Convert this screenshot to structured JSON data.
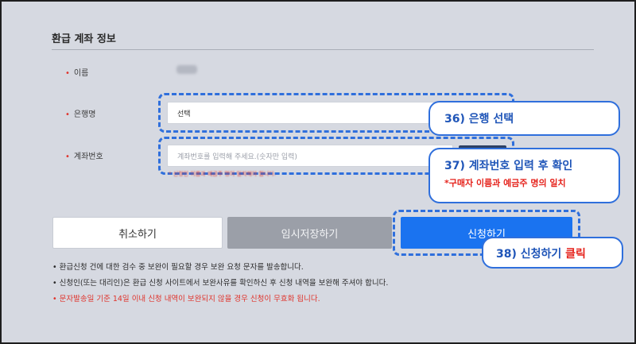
{
  "section": {
    "title": "환급 계좌 정보"
  },
  "fields": {
    "name_label": "이름",
    "bank_label": "은행명",
    "bank_value": "선택",
    "account_label": "계좌번호",
    "account_placeholder": "계좌번호를 입력해 주세요.(숫자만 입력)",
    "required_marker": "•",
    "account_warning": "* 신청인 이름과 예금주 명이 일치해야 합니다."
  },
  "buttons": {
    "cancel": "취소하기",
    "temp_save": "임시저장하기",
    "apply": "신청하기"
  },
  "callouts": {
    "c36": "36) 은행 선택",
    "c37": "37) 계좌번호 입력 후 확인",
    "c37_sub": "*구매자 이름과 예금주 명의 일치",
    "c38_prefix": "38) 신청하기 ",
    "c38_highlight": "클릭"
  },
  "notes": [
    "• 환급신청 건에 대한 검수 중 보완이 필요할 경우 보완 요청 문자를 발송합니다.",
    "• 신청인(또는 대리인)은 환급 신청 사이트에서 보완사유를 확인하신 후 신청 내역을 보완해 주셔야 합니다.",
    "• 문자발송일 기준 14일 이내 신청 내역이 보완되지 않을 경우 신청이 무효화 됩니다."
  ],
  "colors": {
    "accent": "#1a73f0",
    "callout_border": "#2f6fdc",
    "warning": "#e5231c"
  }
}
